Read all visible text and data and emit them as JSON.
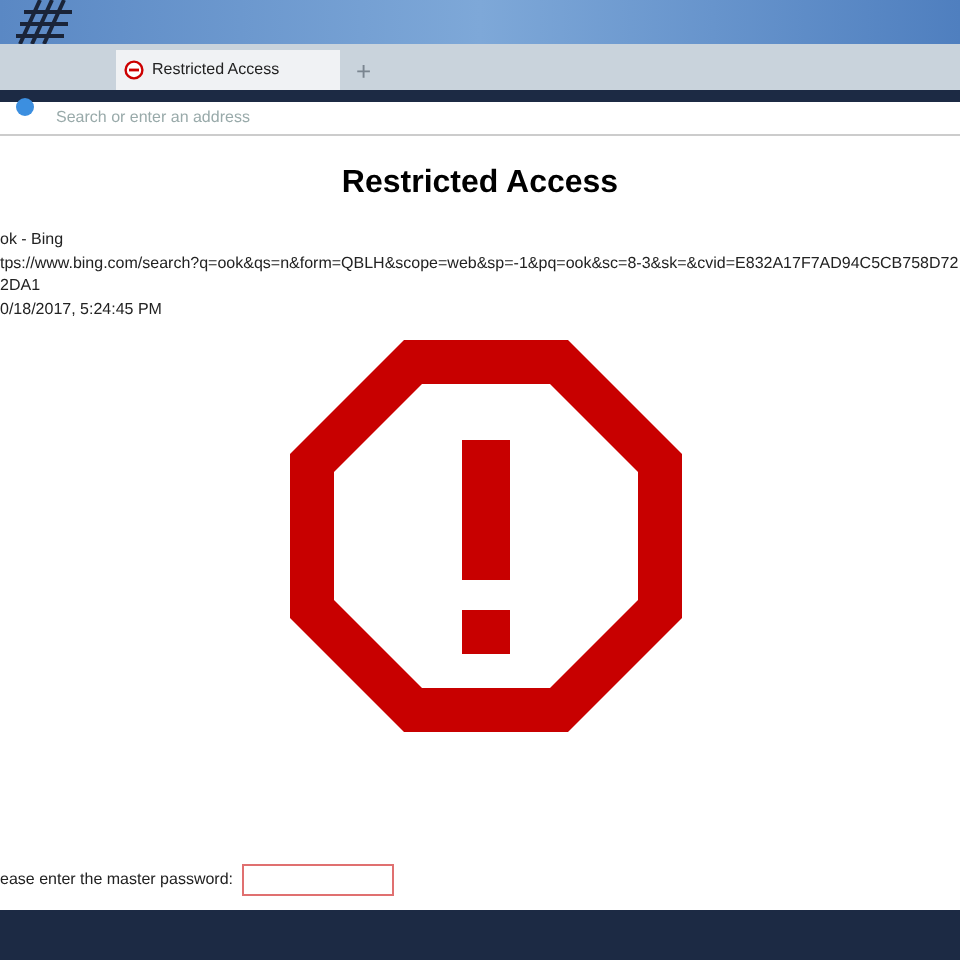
{
  "tabs": [
    {
      "title": "Restricted Access",
      "selected": true
    }
  ],
  "new_tab": "+",
  "address_bar": {
    "placeholder": "Search or enter an address"
  },
  "page": {
    "title": "Restricted Access",
    "details": [
      "ok - Bing",
      "tps://www.bing.com/search?q=ook&qs=n&form=QBLH&scope=web&sp=-1&pq=ook&sc=8-3&sk=&cvid=E832A17F7AD94C5CB758D722DA1",
      "0/18/2017, 5:24:45 PM"
    ],
    "password_label": "ease enter the master password:"
  }
}
